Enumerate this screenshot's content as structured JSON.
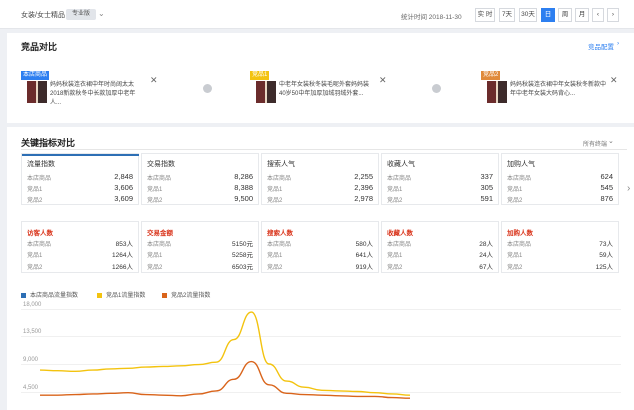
{
  "header": {
    "category": "女装/女士精品",
    "badge": "专业版",
    "stat_time": "统计时间 2018-11-30",
    "time_buttons": [
      "实 时",
      "7天",
      "30天",
      "日",
      "周",
      "月"
    ],
    "active_time": "日"
  },
  "compare": {
    "title": "竞品对比",
    "config_link": "竞品配置",
    "products": [
      {
        "tag": "本店商品",
        "tag_color": "#2d7ff0",
        "text": "妈妈秋装连衣裙中年时尚阔太太2018新款秋冬中长款加厚中老年人..."
      },
      {
        "tag": "竞品1",
        "tag_color": "#f3c30f",
        "text": "中老年女装秋冬装毛呢外套妈妈装40岁50中年加厚加绒羽绒外套..."
      },
      {
        "tag": "竞品2",
        "tag_color": "#e08a3b",
        "text": "妈妈秋装连衣裙中年女装秋冬新款中年中老年女装大码背心..."
      }
    ]
  },
  "indicators": {
    "title": "关键指标对比",
    "selector": "所有终端",
    "row1": [
      {
        "title": "流量指数",
        "rows": [
          [
            "本店商品",
            "2,848"
          ],
          [
            "竞品1",
            "3,606"
          ],
          [
            "竞品2",
            "3,609"
          ]
        ]
      },
      {
        "title": "交易指数",
        "rows": [
          [
            "本店商品",
            "8,286"
          ],
          [
            "竞品1",
            "8,388"
          ],
          [
            "竞品2",
            "9,500"
          ]
        ]
      },
      {
        "title": "搜索人气",
        "rows": [
          [
            "本店商品",
            "2,255"
          ],
          [
            "竞品1",
            "2,396"
          ],
          [
            "竞品2",
            "2,978"
          ]
        ]
      },
      {
        "title": "收藏人气",
        "rows": [
          [
            "本店商品",
            "337"
          ],
          [
            "竞品1",
            "305"
          ],
          [
            "竞品2",
            "591"
          ]
        ]
      },
      {
        "title": "加购人气",
        "rows": [
          [
            "本店商品",
            "624"
          ],
          [
            "竞品1",
            "545"
          ],
          [
            "竞品2",
            "876"
          ]
        ]
      }
    ],
    "row2": [
      {
        "title": "访客人数",
        "rows": [
          [
            "本店商品",
            "853人"
          ],
          [
            "竞品1",
            "1264人"
          ],
          [
            "竞品2",
            "1266人"
          ]
        ]
      },
      {
        "title": "交易金额",
        "rows": [
          [
            "本店商品",
            "5150元"
          ],
          [
            "竞品1",
            "5258元"
          ],
          [
            "竞品2",
            "6503元"
          ]
        ]
      },
      {
        "title": "搜索人数",
        "rows": [
          [
            "本店商品",
            "580人"
          ],
          [
            "竞品1",
            "641人"
          ],
          [
            "竞品2",
            "919人"
          ]
        ]
      },
      {
        "title": "收藏人数",
        "rows": [
          [
            "本店商品",
            "28人"
          ],
          [
            "竞品1",
            "24人"
          ],
          [
            "竞品2",
            "67人"
          ]
        ]
      },
      {
        "title": "加购人数",
        "rows": [
          [
            "本店商品",
            "73人"
          ],
          [
            "竞品1",
            "59人"
          ],
          [
            "竞品2",
            "125人"
          ]
        ]
      }
    ]
  },
  "chart_data": {
    "type": "line",
    "title": "",
    "series": [
      {
        "name": "本店商品流量指数",
        "color": "#2d6fb5",
        "values": []
      },
      {
        "name": "竞品1流量指数",
        "color": "#f3c30f",
        "values": [
          8000,
          7900,
          7800,
          8000,
          8200,
          8300,
          8500,
          8600,
          8700,
          8900,
          9300,
          13000,
          17500,
          9000,
          6200,
          5200,
          4700,
          4600,
          4500,
          4300,
          4100,
          3900
        ]
      },
      {
        "name": "竞品2流量指数",
        "color": "#d9641b",
        "values": [
          3900,
          3900,
          4000,
          4100,
          4200,
          4300,
          4000,
          3900,
          3800,
          4100,
          4600,
          6500,
          9400,
          5600,
          4200,
          4000,
          3900,
          3800,
          3700,
          3700,
          3500,
          3400
        ]
      }
    ],
    "yticks": [
      "18,000",
      "13,500",
      "9,000",
      "4,500"
    ],
    "ylim": [
      0,
      18000
    ]
  }
}
